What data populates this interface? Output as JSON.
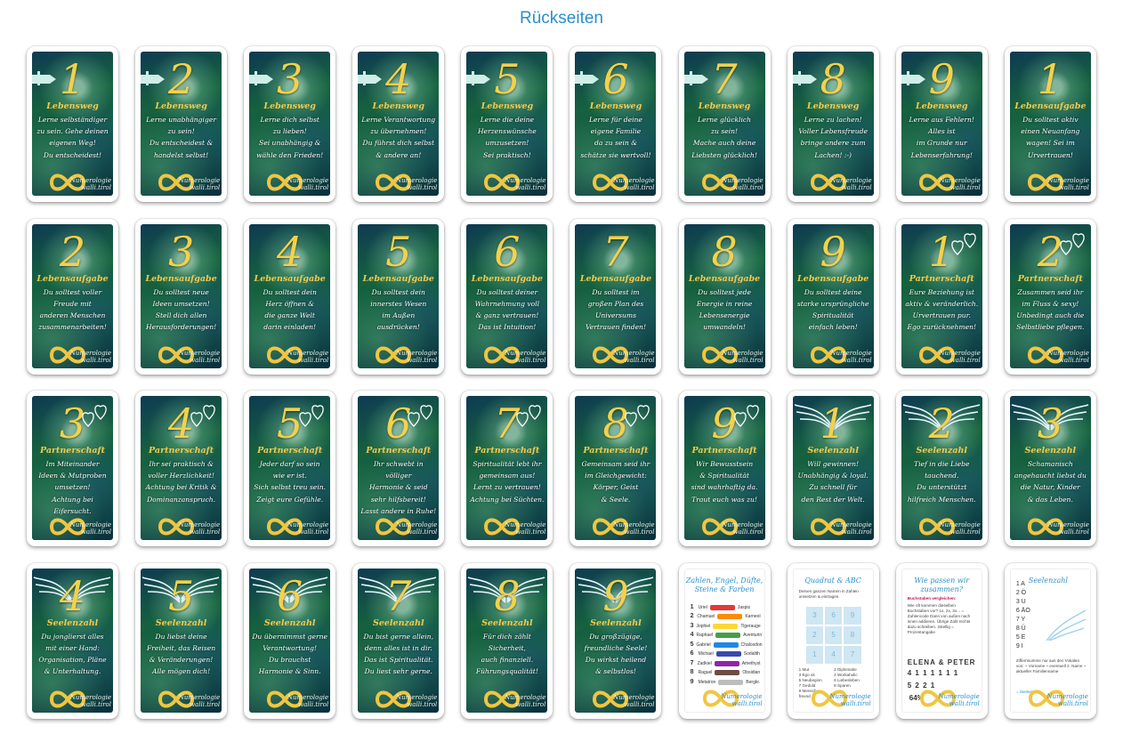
{
  "page": {
    "title": "Rückseiten"
  },
  "brand": {
    "line1": "Numerologie",
    "line2": "walli.tirol"
  },
  "colors": {
    "title": "#2a8fc9",
    "number": "#f2d24b",
    "category": "#f2c94c"
  },
  "dark_cards": [
    {
      "num": "1",
      "cat": "Lebensweg",
      "lines": [
        "Lerne selbständiger",
        "zu sein. Gehe deinen",
        "eigenen Weg!",
        "Du entscheidest!"
      ],
      "deco": "sign"
    },
    {
      "num": "2",
      "cat": "Lebensweg",
      "lines": [
        "Lerne unabhängiger",
        "zu sein!",
        "Du entscheidest &",
        "handelst selbst!"
      ],
      "deco": "sign"
    },
    {
      "num": "3",
      "cat": "Lebensweg",
      "lines": [
        "Lerne dich selbst",
        "zu lieben!",
        "Sei unabhängig &",
        "wähle den Frieden!"
      ],
      "deco": "sign"
    },
    {
      "num": "4",
      "cat": "Lebensweg",
      "lines": [
        "Lerne Verantwortung",
        "zu übernehmen!",
        "Du führst dich selbst",
        "& andere an!"
      ],
      "deco": "sign"
    },
    {
      "num": "5",
      "cat": "Lebensweg",
      "lines": [
        "Lerne die deine",
        "Herzenswünsche",
        "umzusetzen!",
        "Sei praktisch!"
      ],
      "deco": "sign"
    },
    {
      "num": "6",
      "cat": "Lebensweg",
      "lines": [
        "Lerne für deine",
        "eigene Familie",
        "da zu sein &",
        "schätze sie wertvoll!"
      ],
      "deco": "sign"
    },
    {
      "num": "7",
      "cat": "Lebensweg",
      "lines": [
        "Lerne glücklich",
        "zu sein!",
        "Mache auch deine",
        "Liebsten glücklich!"
      ],
      "deco": "sign"
    },
    {
      "num": "8",
      "cat": "Lebensweg",
      "lines": [
        "Lerne zu lachen!",
        "Voller Lebensfreude",
        "bringe andere zum",
        "Lachen! :-)"
      ],
      "deco": "sign"
    },
    {
      "num": "9",
      "cat": "Lebensweg",
      "lines": [
        "Lerne aus Fehlern!",
        "Alles ist",
        "im Grunde nur",
        "Lebenserfahrung!"
      ],
      "deco": "sign"
    },
    {
      "num": "1",
      "cat": "Lebensaufgabe",
      "lines": [
        "Du solltest aktiv",
        "einen Neuanfang",
        "wagen! Sei im",
        "Urvertrauen!"
      ],
      "deco": "none"
    },
    {
      "num": "2",
      "cat": "Lebensaufgabe",
      "lines": [
        "Du solltest voller",
        "Freude mit",
        "anderen Menschen",
        "zusammenarbeiten!"
      ],
      "deco": "none"
    },
    {
      "num": "3",
      "cat": "Lebensaufgabe",
      "lines": [
        "Du solltest neue",
        "Ideen umsetzen!",
        "Stell dich allen",
        "Herausforderungen!"
      ],
      "deco": "none"
    },
    {
      "num": "4",
      "cat": "Lebensaufgabe",
      "lines": [
        "Du solltest dein",
        "Herz öffnen &",
        "die ganze Welt",
        "darin einladen!"
      ],
      "deco": "none"
    },
    {
      "num": "5",
      "cat": "Lebensaufgabe",
      "lines": [
        "Du solltest dein",
        "innerstes Wesen",
        "im Außen",
        "ausdrücken!"
      ],
      "deco": "none"
    },
    {
      "num": "6",
      "cat": "Lebensaufgabe",
      "lines": [
        "Du solltest deiner",
        "Wahrnehmung voll",
        "& ganz vertrauen!",
        "Das ist Intuition!"
      ],
      "deco": "none"
    },
    {
      "num": "7",
      "cat": "Lebensaufgabe",
      "lines": [
        "Du solltest im",
        "großen Plan des",
        "Universums",
        "Vertrauen finden!"
      ],
      "deco": "none"
    },
    {
      "num": "8",
      "cat": "Lebensaufgabe",
      "lines": [
        "Du solltest jede",
        "Energie in reine",
        "Lebensenergie",
        "umwandeln!"
      ],
      "deco": "none"
    },
    {
      "num": "9",
      "cat": "Lebensaufgabe",
      "lines": [
        "Du solltest deine",
        "starke ursprüngliche",
        "Spiritualität",
        "einfach leben!"
      ],
      "deco": "none"
    },
    {
      "num": "1",
      "cat": "Partnerschaft",
      "lines": [
        "Eure Beziehung ist",
        "aktiv & veränderlich.",
        "Urvertrauen pur.",
        "Ego zurücknehmen!"
      ],
      "deco": "hearts"
    },
    {
      "num": "2",
      "cat": "Partnerschaft",
      "lines": [
        "Zusammen seid ihr",
        "im Fluss & sexy!",
        "Unbedingt auch die",
        "Selbstliebe pflegen."
      ],
      "deco": "hearts"
    },
    {
      "num": "3",
      "cat": "Partnerschaft",
      "lines": [
        "Im Miteinander",
        "Ideen & Mutproben",
        "umsetzen!",
        "Achtung bei Eifersucht."
      ],
      "deco": "hearts"
    },
    {
      "num": "4",
      "cat": "Partnerschaft",
      "lines": [
        "Ihr sei praktisch &",
        "voller Herzlichkeit!",
        "Achtung bei Kritik &",
        "Dominanzanspruch."
      ],
      "deco": "hearts"
    },
    {
      "num": "5",
      "cat": "Partnerschaft",
      "lines": [
        "Jeder darf so sein",
        "wie er ist.",
        "Sich selbst treu sein.",
        "Zeigt eure Gefühle."
      ],
      "deco": "hearts"
    },
    {
      "num": "6",
      "cat": "Partnerschaft",
      "lines": [
        "Ihr schwebt in völliger",
        "Harmonie & seid",
        "sehr hilfsbereit!",
        "Lasst andere in Ruhe!"
      ],
      "deco": "hearts"
    },
    {
      "num": "7",
      "cat": "Partnerschaft",
      "lines": [
        "Spiritualität lebt ihr",
        "gemeinsam aus!",
        "Lernt zu vertrauen!",
        "Achtung bei Süchten."
      ],
      "deco": "hearts"
    },
    {
      "num": "8",
      "cat": "Partnerschaft",
      "lines": [
        "Gemeinsam seid ihr",
        "im Gleichgewicht:",
        "Körper, Geist",
        "& Seele."
      ],
      "deco": "hearts"
    },
    {
      "num": "9",
      "cat": "Partnerschaft",
      "lines": [
        "Wir Bewusstsein",
        "& Spiritualität",
        "sind wahrhaftig da.",
        "Traut euch was zu!"
      ],
      "deco": "hearts"
    },
    {
      "num": "1",
      "cat": "Seelenzahl",
      "lines": [
        "Will gewinnen!",
        "Unabhängig & loyal.",
        "Zu schnell für",
        "den Rest der Welt."
      ],
      "deco": "wings"
    },
    {
      "num": "2",
      "cat": "Seelenzahl",
      "lines": [
        "Tief in die Liebe",
        "tauchend.",
        "Du unterstützt",
        "hilfreich Menschen."
      ],
      "deco": "wings"
    },
    {
      "num": "3",
      "cat": "Seelenzahl",
      "lines": [
        "Schamanisch",
        "angehaucht liebst du",
        "die Natur, Kinder",
        "& das Leben."
      ],
      "deco": "wings"
    },
    {
      "num": "4",
      "cat": "Seelenzahl",
      "lines": [
        "Du jonglierst alles",
        "mit einer Hand:",
        "Organisation, Pläne",
        "& Unterhaltung."
      ],
      "deco": "wings"
    },
    {
      "num": "5",
      "cat": "Seelenzahl",
      "lines": [
        "Du liebst deine",
        "Freiheit, das Reisen",
        "& Veränderungen!",
        "Alle mögen dich!"
      ],
      "deco": "wings"
    },
    {
      "num": "6",
      "cat": "Seelenzahl",
      "lines": [
        "Du übernimmst gerne",
        "Verantwortung!",
        "Du brauchst",
        "Harmonie & Sinn."
      ],
      "deco": "wings"
    },
    {
      "num": "7",
      "cat": "Seelenzahl",
      "lines": [
        "Du bist gerne allein,",
        "denn alles ist in dir.",
        "Das ist Spiritualität.",
        "Du liest sehr gerne."
      ],
      "deco": "wings"
    },
    {
      "num": "8",
      "cat": "Seelenzahl",
      "lines": [
        "Für dich zählt",
        "Sicherheit,",
        "auch finanziell.",
        "Führungsqualität!"
      ],
      "deco": "wings"
    },
    {
      "num": "9",
      "cat": "Seelenzahl",
      "lines": [
        "Du großzügige,",
        "freundliche Seele!",
        "Du wirkst heilend",
        "& selbstlos!"
      ],
      "deco": "wings"
    }
  ],
  "light_cards": {
    "zahlen": {
      "title": "Zahlen, Engel, Düfte, Steine & Farben",
      "rows": [
        {
          "n": "1",
          "a": "Uriel",
          "b": "Jaspis",
          "color": "#e53935"
        },
        {
          "n": "2",
          "a": "Chamuel",
          "b": "Karneol",
          "color": "#fb8c00"
        },
        {
          "n": "3",
          "a": "Jophiel",
          "b": "Tigerauge",
          "color": "#fdd835"
        },
        {
          "n": "4",
          "a": "Raphael",
          "b": "Aventurin",
          "color": "#43a047"
        },
        {
          "n": "5",
          "a": "Gabriel",
          "b": "Chalcedon",
          "color": "#1e88e5"
        },
        {
          "n": "6",
          "a": "Michael",
          "b": "Sodalith",
          "color": "#3949ab"
        },
        {
          "n": "7",
          "a": "Zadkiel",
          "b": "Amethyst",
          "color": "#8e24aa"
        },
        {
          "n": "8",
          "a": "Raguel",
          "b": "Obsidian",
          "color": "#6d4c41"
        },
        {
          "n": "9",
          "a": "Metatron",
          "b": "Bergkr.",
          "color": "#bdbdbd"
        }
      ]
    },
    "quadrat": {
      "title": "Quadrat & ABC",
      "intro": "Deinen ganzen Namen in Zahlen umsetzen & eintragen.",
      "cells": [
        "3",
        "6",
        "9",
        "2",
        "5",
        "8",
        "1",
        "4",
        "7"
      ],
      "legend": [
        "1 Mut",
        "2 Diplomatie",
        "3 Ego ok",
        "4 Workaholic",
        "5 Neubeginn",
        "6 Liebesleben",
        "7 Geduld",
        "8 Sparen",
        "9 Menschen-freund"
      ]
    },
    "passen": {
      "title": "Wie passen wir zusammen?",
      "subtitle": "Buchstaben vergleichen:",
      "text": "Wie oft kommen dieselben Buchstaben vor? 1x, 2x, 3x... = Zahlencode Dann von außen nach innen addieren. Übrige Zahl rechts dazu schreiben. 2stellig = Prozentangabe",
      "names": "ELENA & PETER",
      "digits": "4 1 1 1 1 1 1",
      "sum": "5 2 2 1",
      "percent": "64%"
    },
    "seelenzahl": {
      "title": "Seelenzahl",
      "list": [
        "1 A",
        "2 Ö",
        "3 U",
        "6 ÄO",
        "7 Y",
        "8 Ü",
        "5 E",
        "9 I"
      ],
      "text": "Ziffernsumme nur aus den Vokalen von: ~ Vorname ~ eventuell 2. Name ~ aktueller Familienname",
      "footer": "= Seelenzahl"
    }
  }
}
